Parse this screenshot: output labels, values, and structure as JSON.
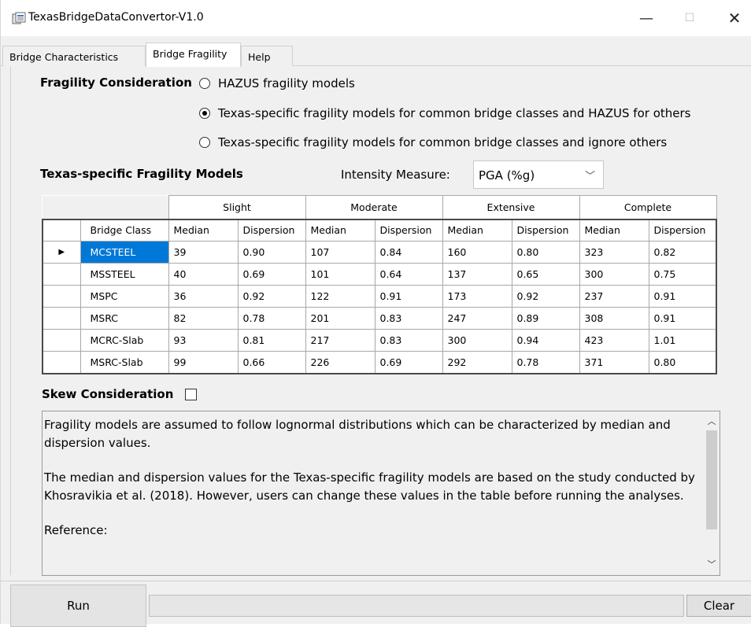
{
  "window": {
    "title": "TexasBridgeDataConvertor-V1.0",
    "min_glyph": "—",
    "max_glyph": "☐",
    "close_glyph": "✕"
  },
  "tabs": [
    {
      "label": "Bridge Characteristics"
    },
    {
      "label": "Bridge Fragility"
    },
    {
      "label": "Help"
    }
  ],
  "fragility": {
    "label": "Fragility Consideration",
    "options": [
      {
        "label": "HAZUS fragility models",
        "selected": false
      },
      {
        "label": "Texas-specific fragility models for common bridge classes and HAZUS for others",
        "selected": true
      },
      {
        "label": "Texas-specific fragility models for common bridge classes and ignore others",
        "selected": false
      }
    ]
  },
  "models": {
    "label": "Texas-specific Fragility Models",
    "intensity_label": "Intensity Measure:",
    "intensity_value": "PGA (%g)"
  },
  "table": {
    "groups": [
      "Slight",
      "Moderate",
      "Extensive",
      "Complete"
    ],
    "columns": [
      "Bridge Class",
      "Median",
      "Dispersion",
      "Median",
      "Dispersion",
      "Median",
      "Dispersion",
      "Median",
      "Dispersion"
    ],
    "row_marker": "▶",
    "rows": [
      [
        "MCSTEEL",
        "39",
        "0.90",
        "107",
        "0.84",
        "160",
        "0.80",
        "323",
        "0.82"
      ],
      [
        "MSSTEEL",
        "40",
        "0.69",
        "101",
        "0.64",
        "137",
        "0.65",
        "300",
        "0.75"
      ],
      [
        "MSPC",
        "36",
        "0.92",
        "122",
        "0.91",
        "173",
        "0.92",
        "237",
        "0.91"
      ],
      [
        "MSRC",
        "82",
        "0.78",
        "201",
        "0.83",
        "247",
        "0.89",
        "308",
        "0.91"
      ],
      [
        "MCRC-Slab",
        "93",
        "0.81",
        "217",
        "0.83",
        "300",
        "0.94",
        "423",
        "1.01"
      ],
      [
        "MSRC-Slab",
        "99",
        "0.66",
        "226",
        "0.69",
        "292",
        "0.78",
        "371",
        "0.80"
      ]
    ]
  },
  "skew": {
    "label": "Skew Consideration",
    "checked": false
  },
  "info": {
    "p1": "Fragility models are assumed to follow lognormal distributions which can be characterized by median and dispersion values.",
    "p2": "The median and dispersion values for the Texas-specific fragility models are based on the study conducted by Khosravikia et al. (2018). However, users can change these values in the table before running the analyses.",
    "p3": "Reference:"
  },
  "buttons": {
    "run": "Run",
    "clear": "Clear"
  },
  "colors": {
    "selection": "#0078d7",
    "background": "#f0f0f0"
  }
}
